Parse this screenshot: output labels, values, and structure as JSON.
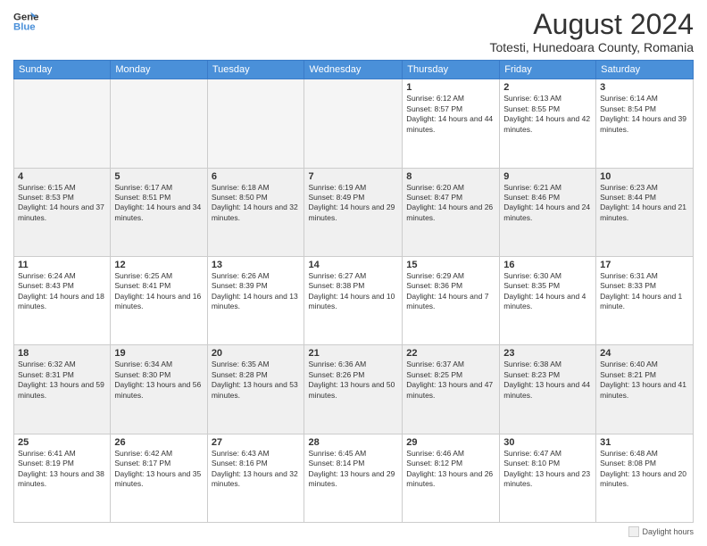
{
  "header": {
    "logo_line1": "General",
    "logo_line2": "Blue",
    "title": "August 2024",
    "subtitle": "Totesti, Hunedoara County, Romania"
  },
  "days_of_week": [
    "Sunday",
    "Monday",
    "Tuesday",
    "Wednesday",
    "Thursday",
    "Friday",
    "Saturday"
  ],
  "weeks": [
    [
      {
        "day": "",
        "empty": true
      },
      {
        "day": "",
        "empty": true
      },
      {
        "day": "",
        "empty": true
      },
      {
        "day": "",
        "empty": true
      },
      {
        "day": "1",
        "sunrise": "6:12 AM",
        "sunset": "8:57 PM",
        "daylight": "14 hours and 44 minutes."
      },
      {
        "day": "2",
        "sunrise": "6:13 AM",
        "sunset": "8:55 PM",
        "daylight": "14 hours and 42 minutes."
      },
      {
        "day": "3",
        "sunrise": "6:14 AM",
        "sunset": "8:54 PM",
        "daylight": "14 hours and 39 minutes."
      }
    ],
    [
      {
        "day": "4",
        "sunrise": "6:15 AM",
        "sunset": "8:53 PM",
        "daylight": "14 hours and 37 minutes.",
        "shaded": true
      },
      {
        "day": "5",
        "sunrise": "6:17 AM",
        "sunset": "8:51 PM",
        "daylight": "14 hours and 34 minutes.",
        "shaded": true
      },
      {
        "day": "6",
        "sunrise": "6:18 AM",
        "sunset": "8:50 PM",
        "daylight": "14 hours and 32 minutes.",
        "shaded": true
      },
      {
        "day": "7",
        "sunrise": "6:19 AM",
        "sunset": "8:49 PM",
        "daylight": "14 hours and 29 minutes.",
        "shaded": true
      },
      {
        "day": "8",
        "sunrise": "6:20 AM",
        "sunset": "8:47 PM",
        "daylight": "14 hours and 26 minutes.",
        "shaded": true
      },
      {
        "day": "9",
        "sunrise": "6:21 AM",
        "sunset": "8:46 PM",
        "daylight": "14 hours and 24 minutes.",
        "shaded": true
      },
      {
        "day": "10",
        "sunrise": "6:23 AM",
        "sunset": "8:44 PM",
        "daylight": "14 hours and 21 minutes.",
        "shaded": true
      }
    ],
    [
      {
        "day": "11",
        "sunrise": "6:24 AM",
        "sunset": "8:43 PM",
        "daylight": "14 hours and 18 minutes."
      },
      {
        "day": "12",
        "sunrise": "6:25 AM",
        "sunset": "8:41 PM",
        "daylight": "14 hours and 16 minutes."
      },
      {
        "day": "13",
        "sunrise": "6:26 AM",
        "sunset": "8:39 PM",
        "daylight": "14 hours and 13 minutes."
      },
      {
        "day": "14",
        "sunrise": "6:27 AM",
        "sunset": "8:38 PM",
        "daylight": "14 hours and 10 minutes."
      },
      {
        "day": "15",
        "sunrise": "6:29 AM",
        "sunset": "8:36 PM",
        "daylight": "14 hours and 7 minutes."
      },
      {
        "day": "16",
        "sunrise": "6:30 AM",
        "sunset": "8:35 PM",
        "daylight": "14 hours and 4 minutes."
      },
      {
        "day": "17",
        "sunrise": "6:31 AM",
        "sunset": "8:33 PM",
        "daylight": "14 hours and 1 minute."
      }
    ],
    [
      {
        "day": "18",
        "sunrise": "6:32 AM",
        "sunset": "8:31 PM",
        "daylight": "13 hours and 59 minutes.",
        "shaded": true
      },
      {
        "day": "19",
        "sunrise": "6:34 AM",
        "sunset": "8:30 PM",
        "daylight": "13 hours and 56 minutes.",
        "shaded": true
      },
      {
        "day": "20",
        "sunrise": "6:35 AM",
        "sunset": "8:28 PM",
        "daylight": "13 hours and 53 minutes.",
        "shaded": true
      },
      {
        "day": "21",
        "sunrise": "6:36 AM",
        "sunset": "8:26 PM",
        "daylight": "13 hours and 50 minutes.",
        "shaded": true
      },
      {
        "day": "22",
        "sunrise": "6:37 AM",
        "sunset": "8:25 PM",
        "daylight": "13 hours and 47 minutes.",
        "shaded": true
      },
      {
        "day": "23",
        "sunrise": "6:38 AM",
        "sunset": "8:23 PM",
        "daylight": "13 hours and 44 minutes.",
        "shaded": true
      },
      {
        "day": "24",
        "sunrise": "6:40 AM",
        "sunset": "8:21 PM",
        "daylight": "13 hours and 41 minutes.",
        "shaded": true
      }
    ],
    [
      {
        "day": "25",
        "sunrise": "6:41 AM",
        "sunset": "8:19 PM",
        "daylight": "13 hours and 38 minutes."
      },
      {
        "day": "26",
        "sunrise": "6:42 AM",
        "sunset": "8:17 PM",
        "daylight": "13 hours and 35 minutes."
      },
      {
        "day": "27",
        "sunrise": "6:43 AM",
        "sunset": "8:16 PM",
        "daylight": "13 hours and 32 minutes."
      },
      {
        "day": "28",
        "sunrise": "6:45 AM",
        "sunset": "8:14 PM",
        "daylight": "13 hours and 29 minutes."
      },
      {
        "day": "29",
        "sunrise": "6:46 AM",
        "sunset": "8:12 PM",
        "daylight": "13 hours and 26 minutes."
      },
      {
        "day": "30",
        "sunrise": "6:47 AM",
        "sunset": "8:10 PM",
        "daylight": "13 hours and 23 minutes."
      },
      {
        "day": "31",
        "sunrise": "6:48 AM",
        "sunset": "8:08 PM",
        "daylight": "13 hours and 20 minutes."
      }
    ]
  ],
  "footer": {
    "legend_label": "Daylight hours"
  }
}
